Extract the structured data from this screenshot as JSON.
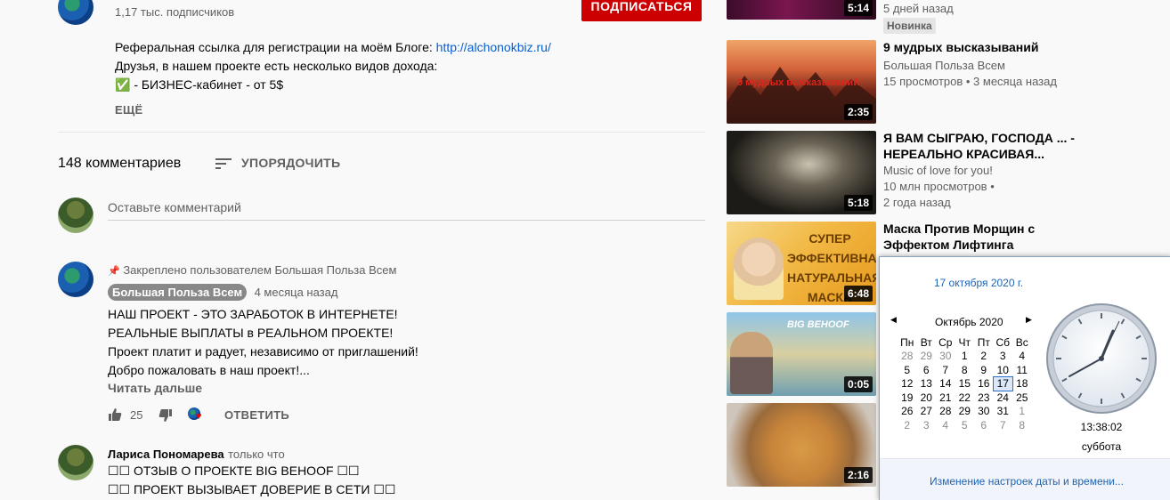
{
  "channel": {
    "subscribers": "1,17 тыс. подписчиков",
    "subscribe_label": "ПОДПИСАТЬСЯ"
  },
  "description": {
    "line1_prefix": "Реферальная ссылка для регистрации на моём Блоге: ",
    "line1_link": "http://alchonokbiz.ru/",
    "line2": "Друзья, в нашем проекте есть несколько видов дохода:",
    "line3": "✅ - БИЗНЕС-кабинет - от 5$",
    "more_label": "ЕЩЁ"
  },
  "comments_header": {
    "count_label": "148 комментариев",
    "sort_label": "УПОРЯДОЧИТЬ"
  },
  "comment_box": {
    "placeholder": "Оставьте комментарий"
  },
  "comments": [
    {
      "pinned_label": "Закреплено пользователем Большая Польза Всем",
      "author": "Большая Польза Всем",
      "time": "4 месяца назад",
      "lines": [
        "НАШ ПРОЕКТ - ЭТО ЗАРАБОТОК В ИНТЕРНЕТЕ!",
        "РЕАЛЬНЫЕ ВЫПЛАТЫ в РЕАЛЬНОМ ПРОЕКТЕ!",
        "Проект платит и радует, независимо от приглашений!",
        "Добро пожаловать в наш проект!..."
      ],
      "read_more": "Читать дальше",
      "likes": "25",
      "reply_label": "ОТВЕТИТЬ"
    },
    {
      "author": "Лариса Пономарева",
      "time": "только что",
      "lines": [
        "☐☐ ОТЗЫВ О ПРОЕКТЕ BIG BEHOOF ☐☐",
        "☐☐ ПРОЕКТ ВЫЗЫВАЕТ ДОВЕРИЕ В СЕТИ ☐☐"
      ]
    }
  ],
  "sidebar": {
    "top": {
      "duration": "5:14",
      "meta": "5 дней назад",
      "badge": "Новинка"
    },
    "videos": [
      {
        "title1": "9 мудрых высказываний",
        "title2": "",
        "channel": "Большая Польза Всем",
        "meta1": "15 просмотров • 3 месяца назад",
        "meta2": "",
        "duration": "2:35",
        "thumb_text": "9 мудрых высказываний"
      },
      {
        "title1": "Я ВАМ СЫГРАЮ, ГОСПОДА ... -",
        "title2": "НЕРЕАЛЬНО КРАСИВАЯ...",
        "channel": "Music of love for you!",
        "meta1": "10 млн просмотров •",
        "meta2": "2 года назад",
        "duration": "5:18",
        "thumb_text": ""
      },
      {
        "title1": "Маска Против Морщин с",
        "title2": "Эффектом Лифтинга",
        "channel": "",
        "meta1": "",
        "meta2": "",
        "duration": "6:48",
        "thumb_text": "СУПЕР ЭФФЕКТИВНАЯ НАТУРАЛЬНАЯ МАСКА"
      },
      {
        "title1": "",
        "title2": "",
        "channel": "",
        "meta1": "",
        "meta2": "",
        "duration": "0:05",
        "thumb_text": "BIG BEHOOF"
      },
      {
        "title1": "",
        "title2": "",
        "channel": "",
        "meta1": "",
        "meta2": "",
        "duration": "2:16",
        "thumb_text": ""
      }
    ]
  },
  "clock_popup": {
    "date_header": "17 октября 2020 г.",
    "month_label": "Октябрь 2020",
    "weekdays": [
      "Пн",
      "Вт",
      "Ср",
      "Чт",
      "Пт",
      "Сб",
      "Вс"
    ],
    "weeks": [
      [
        "28",
        "29",
        "30",
        "1",
        "2",
        "3",
        "4"
      ],
      [
        "5",
        "6",
        "7",
        "8",
        "9",
        "10",
        "11"
      ],
      [
        "12",
        "13",
        "14",
        "15",
        "16",
        "17",
        "18"
      ],
      [
        "19",
        "20",
        "21",
        "22",
        "23",
        "24",
        "25"
      ],
      [
        "26",
        "27",
        "28",
        "29",
        "30",
        "31",
        "1"
      ],
      [
        "2",
        "3",
        "4",
        "5",
        "6",
        "7",
        "8"
      ]
    ],
    "time": "13:38:02",
    "day_name": "суббота",
    "settings_link": "Изменение настроек даты и времени..."
  },
  "colors": {
    "link": "#065fd4",
    "subscribe": "#cc0000",
    "popup_link": "#1e63b6"
  }
}
